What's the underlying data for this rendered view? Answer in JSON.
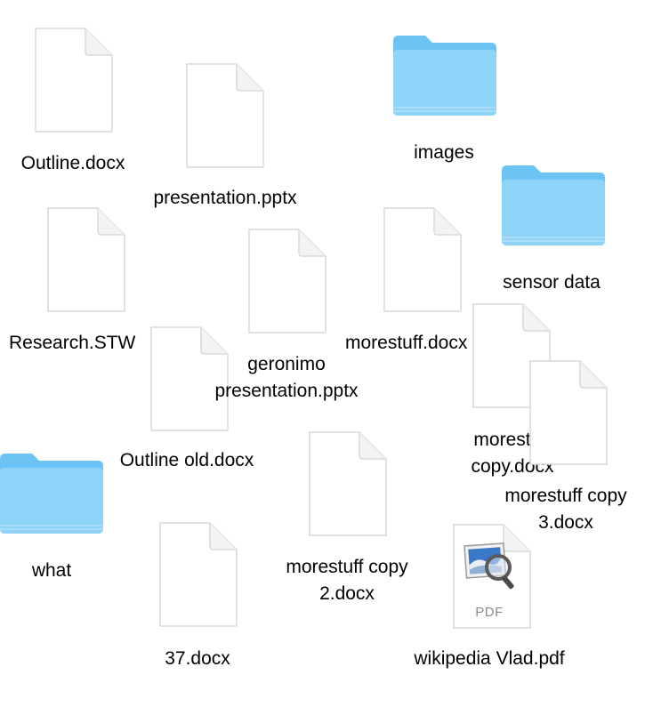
{
  "desktop": {
    "items": [
      {
        "kind": "document",
        "label": "Outline.docx"
      },
      {
        "kind": "document",
        "label": "presentation.pptx"
      },
      {
        "kind": "folder",
        "label": "images"
      },
      {
        "kind": "folder",
        "label": "sensor data"
      },
      {
        "kind": "document",
        "label": "Research.STW"
      },
      {
        "kind": "document",
        "label": "geronimo\npresentation.pptx"
      },
      {
        "kind": "document",
        "label": "morestuff.docx"
      },
      {
        "kind": "document",
        "label": "Outline old.docx"
      },
      {
        "kind": "document",
        "label": "morestuff\ncopy.docx"
      },
      {
        "kind": "document",
        "label": "morestuff copy\n3.docx"
      },
      {
        "kind": "folder",
        "label": "what"
      },
      {
        "kind": "document",
        "label": "morestuff copy\n2.docx"
      },
      {
        "kind": "document",
        "label": "37.docx"
      },
      {
        "kind": "pdf",
        "label": "wikipedia Vlad.pdf",
        "badge": "PDF"
      }
    ]
  },
  "colors": {
    "folder_front": "#8fd3f9",
    "folder_back": "#6cc4f5",
    "document_fill": "#ffffff",
    "document_edge": "#d9d9d9"
  },
  "icons": {
    "document": "blank-document-icon",
    "folder": "blue-folder-icon",
    "pdf": "pdf-preview-icon"
  }
}
